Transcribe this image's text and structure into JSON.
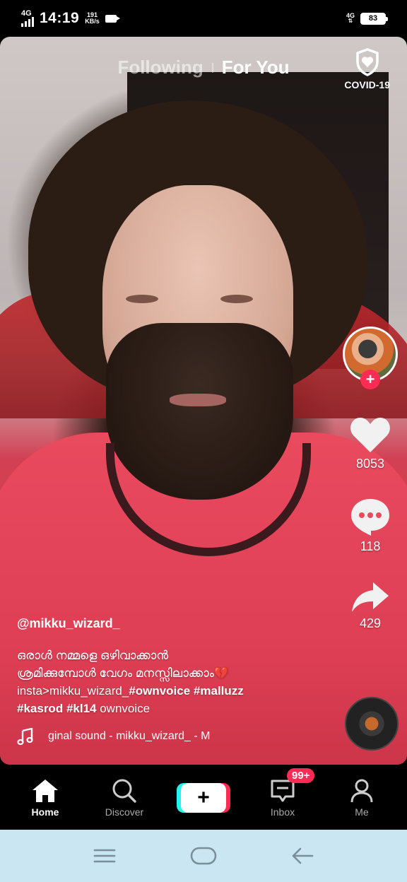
{
  "status_bar": {
    "network_left": "4G",
    "time": "14:19",
    "speed_value": "191",
    "speed_unit": "KB/s",
    "network_right": "4G",
    "battery": "83"
  },
  "top_tabs": {
    "following": "Following",
    "for_you": "For You",
    "covid_label": "COVID-19"
  },
  "rail": {
    "likes": "8053",
    "comments": "118",
    "shares": "429"
  },
  "caption": {
    "username": "@mikku_wizard_",
    "line1": "ഒരാൾ നമ്മളെ ഒഴിവാക്കാൻ",
    "line2": "ശ്രമിക്കുമ്പോൾ വേഗം മനസ്സിലാക്കാം💔",
    "line3_prefix": "insta>mikku_wizard_",
    "tag_ownvoice": "#ownvoice",
    "tag_malluzz": "#malluzz",
    "tag_kasrod": "#kasrod",
    "tag_kl14": "#kl14",
    "suffix": "ownvoice",
    "sound": "ginal sound - mikku_wizard_ - M"
  },
  "nav": {
    "home": "Home",
    "discover": "Discover",
    "inbox": "Inbox",
    "inbox_badge": "99+",
    "me": "Me"
  },
  "colors": {
    "accent_red": "#fe2c55",
    "accent_cyan": "#25f4ee",
    "system_nav_bg": "#c9e6f2"
  }
}
